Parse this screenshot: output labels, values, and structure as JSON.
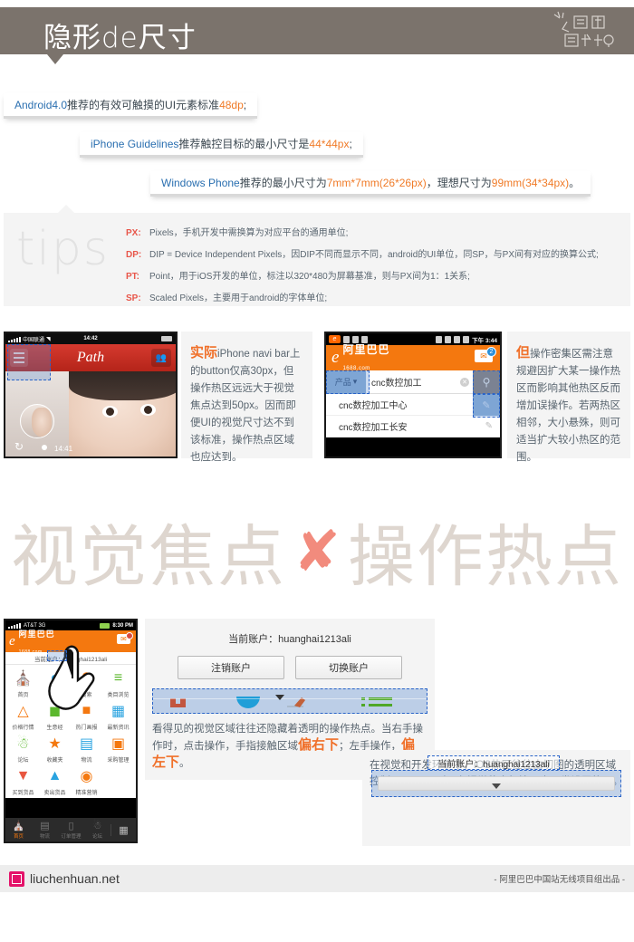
{
  "header": {
    "title": "隐形de尺寸",
    "logo_alt": "视觉设计"
  },
  "callouts": [
    {
      "id": "android",
      "blue": "Android4.0",
      "dark": "推荐的有效可触摸的UI元素标准",
      "orange": "48dp",
      "tail": ";"
    },
    {
      "id": "iphone",
      "blue": "iPhone Guidelines",
      "dark": "推荐触控目标的最小尺寸是",
      "orange": "44*44px",
      "tail": ";"
    },
    {
      "id": "wp",
      "blue": "Windows Phone",
      "dark": "推荐的最小尺寸为",
      "orange": "7mm*7mm(26*26px)",
      "dark2": "，理想尺寸为",
      "orange2": "99mm(34*34px)",
      "tail": "。"
    }
  ],
  "tips": {
    "watermark": "tips",
    "rows": [
      {
        "key": "PX:",
        "val": "Pixels，手机开发中需换算为对应平台的通用单位;"
      },
      {
        "key": "DP:",
        "val": "DIP = Device Independent Pixels，因DIP不同而显示不同，android的UI单位，同SP，与PX间有对应的换算公式;"
      },
      {
        "key": "PT:",
        "val": "Point，用于iOS开发的单位，标注以320*480为屏幕基准，则与PX间为1：1关系;"
      },
      {
        "key": "SP:",
        "val": "Scaled Pixels，主要用于android的字体单位;"
      }
    ]
  },
  "iphone_demo": {
    "status": {
      "carrier": "中国联通",
      "clock": "14:42"
    },
    "navbar": {
      "brand": "Path",
      "menu_icon": "hamburger-icon",
      "friends_icon": "friends-icon"
    },
    "photo": {
      "timestamp": "14:41",
      "refresh_icon": "refresh-icon"
    }
  },
  "note_iphone": {
    "lead": "实际",
    "body": "iPhone navi bar上的button仅高30px，但操作热区远远大于视觉焦点达到50px。因而即便UI的视觉尺寸达不到该标准，操作热点区域也应达到。"
  },
  "android_demo": {
    "status": {
      "time": "下午 3:44"
    },
    "brand": {
      "name": "阿里巴巴",
      "domain": "1688.com"
    },
    "mail_badge": "2",
    "search": {
      "category": "产品",
      "query": "cnc数控加工",
      "search_icon": "magnifier-icon"
    },
    "suggestions": [
      "cnc数控加工中心",
      "cnc数控加工长安"
    ]
  },
  "note_android": {
    "lead": "但",
    "body": "操作密集区需注意规避因扩大某一操作热区而影响其他热区反而增加误操作。若两热区相邻，大小悬殊，则可适当扩大较小热区的范围。"
  },
  "bigtitle": {
    "left": "视觉焦点",
    "cross": "✘",
    "right": "操作热点"
  },
  "android_app": {
    "status": {
      "carrier": "AT&T 3G",
      "time": "8:30 PM"
    },
    "brand": {
      "name": "阿里巴巴",
      "domain": "1688.com"
    },
    "account_line": "当前账户：huanghai1213ali",
    "grid": [
      {
        "label": "首页",
        "icon": "home-icon",
        "glyph": "⌂",
        "color": "#f4780f"
      },
      {
        "label": "旺旺",
        "icon": "wangwang-icon",
        "glyph": "●",
        "color": "#29a3e0"
      },
      {
        "label": "搜索",
        "icon": "search-icon",
        "glyph": "◯",
        "color": "#f4780f"
      },
      {
        "label": "类目浏览",
        "icon": "list-icon",
        "glyph": "≡",
        "color": "#5cb82e"
      },
      {
        "label": "价格行情",
        "icon": "chart-icon",
        "glyph": "◸",
        "color": "#f4780f"
      },
      {
        "label": "生意经",
        "icon": "chat-icon",
        "glyph": "◙",
        "color": "#5cb82e"
      },
      {
        "label": "热门画报",
        "icon": "shirt-icon",
        "glyph": "▣",
        "color": "#f4780f"
      },
      {
        "label": "最新资讯",
        "icon": "news-icon",
        "glyph": "▤",
        "color": "#29a3e0"
      },
      {
        "label": "论坛",
        "icon": "forum-icon",
        "glyph": "◍",
        "color": "#5cb82e"
      },
      {
        "label": "收藏夹",
        "icon": "star-icon",
        "glyph": "★",
        "color": "#f4780f"
      },
      {
        "label": "物流",
        "icon": "truck-icon",
        "glyph": "▤",
        "color": "#29a3e0"
      },
      {
        "label": "采购管理",
        "icon": "clipboard-icon",
        "glyph": "▤",
        "color": "#f4780f"
      },
      {
        "label": "买到货品",
        "icon": "cart-in-icon",
        "glyph": "▼",
        "color": "#e8563f"
      },
      {
        "label": "卖出货品",
        "icon": "cart-out-icon",
        "glyph": "▲",
        "color": "#29a3e0"
      },
      {
        "label": "精准营销",
        "icon": "target-icon",
        "glyph": "◎",
        "color": "#f4780f"
      }
    ],
    "tabs": [
      {
        "label": "首页",
        "glyph": "⌂",
        "active": true
      },
      {
        "label": "物流",
        "glyph": "▤",
        "active": false
      },
      {
        "label": "订单管理",
        "glyph": "▯",
        "active": false
      },
      {
        "label": "论坛",
        "glyph": "◍",
        "active": false
      }
    ],
    "grid_button_icon": "grid-icon"
  },
  "panel_b1": {
    "account_line": "当前账户：huanghai1213ali",
    "buttons": [
      {
        "label": "注销账户",
        "name": "logout-account-button"
      },
      {
        "label": "切换账户",
        "name": "switch-account-button"
      }
    ],
    "paragraph_1": "看得见的视觉区域往往还隐藏着透明的操作热点。当右手操作时，点击操作，手指接触区域",
    "hl_1": "偏右下",
    "paragraph_2": "；左手操作，",
    "hl_2": "偏左下",
    "paragraph_3": "。"
  },
  "panel_b2": {
    "account_label": "当前账户：huanghai1213ali",
    "paragraph": "在视觉和开发环节中，iOS热区往往由切图的透明区域控制，android则可在视觉稿中标注，由开发设置热区。"
  },
  "footer": {
    "site": "liuchenhuan.net",
    "credit": "- 阿里巴巴中国站无线项目组出品 -",
    "logo_icon": "stamp-logo-icon"
  },
  "colors": {
    "header_bg": "#7b736c",
    "orange": "#f0702a",
    "blue": "#2a6fb0",
    "red_tip": "#e8564a",
    "hotzone_border": "#2a64c8",
    "panel_bg": "#f4f4f4",
    "bigtitle_gray": "#ded6cf",
    "bigtitle_x": "#f28b7d"
  }
}
